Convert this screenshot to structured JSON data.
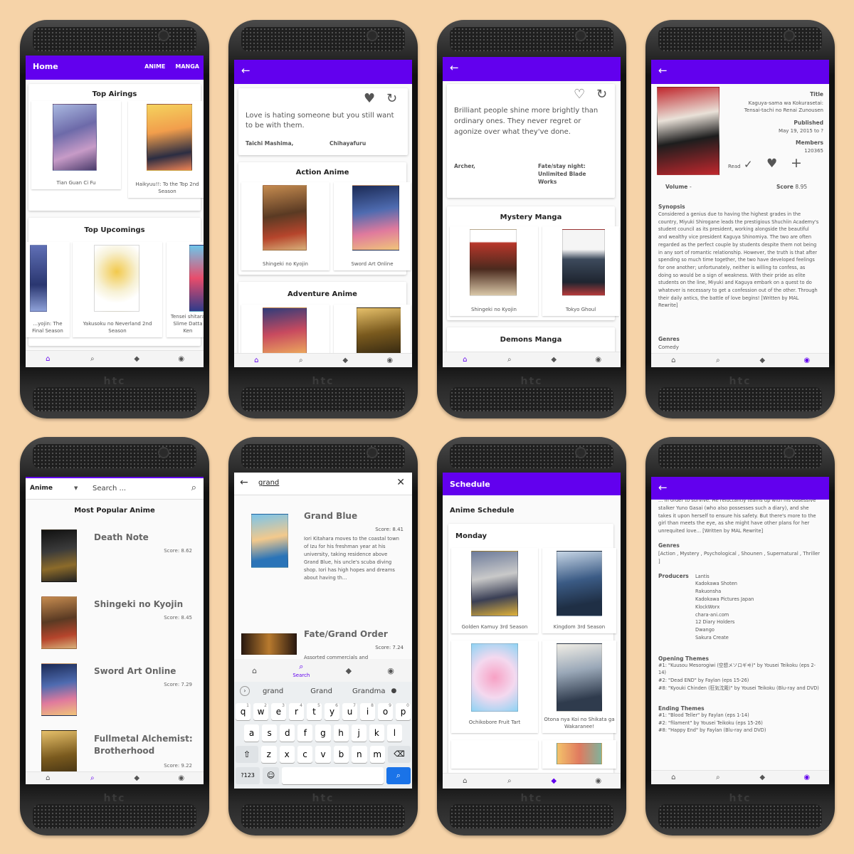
{
  "p1": {
    "title": "Home",
    "tab_anime": "ANIME",
    "tab_manga": "MANGA",
    "top_airings": "Top Airings",
    "air1": "Tian Guan Ci Fu",
    "air2": "Haikyuu!!: To the Top 2nd Season",
    "top_upcomings": "Top Upcomings",
    "up1": "...yojin: The Final Season",
    "up2": "Yakusoku no Neverland 2nd Season",
    "up3": "Tensei shitara Slime Datta Ken"
  },
  "p2": {
    "quote": "Love is hating someone but you still want to be with them.",
    "character": "Taichi Mashima,",
    "source": "Chihayafuru",
    "sec1": "Action Anime",
    "a1": "Shingeki no Kyojin",
    "a2": "Sword Art Online",
    "sec2": "Adventure Anime"
  },
  "p3": {
    "quote": "Brilliant people shine more brightly than ordinary ones. They never regret or agonize over what they've done.",
    "character": "Archer,",
    "source": "Fate/stay night: Unlimited Blade Works",
    "sec1": "Mystery Manga",
    "m1": "Shingeki no Kyojin",
    "m2": "Tokyo Ghoul",
    "sec2": "Demons Manga"
  },
  "p4": {
    "title_label": "Title",
    "title_value": "Kaguya-sama wa Kokurasetai: Tensai-tachi no Renai Zunousen",
    "published_label": "Published",
    "published_value": "May 19, 2015 to ?",
    "members_label": "Members",
    "members_value": "120365",
    "read_label": "Read",
    "volume_label": "Volume",
    "volume_value": "-",
    "score_label": "Score",
    "score_value": "8.95",
    "synopsis_label": "Synopsis",
    "synopsis": "Considered a genius due to having the highest grades in the country, Miyuki Shirogane leads the prestigious Shuchiin Academy's student council as its president, working alongside the beautiful and wealthy vice president Kaguya Shinomiya. The two are often regarded as the perfect couple by students despite them not being in any sort of romantic relationship. However, the truth is that after spending so much time together, the two have developed feelings for one another; unfortunately, neither is willing to confess, as doing so would be a sign of weakness. With their pride as elite students on the line, Miyuki and Kaguya embark on a quest to do whatever is necessary to get a confession out of the other. Through their daily antics, the battle of love begins! [Written by MAL Rewrite]",
    "genres_label": "Genres",
    "genres_value": "Comedy"
  },
  "p5": {
    "dropdown": "Anime",
    "search_placeholder": "Search ...",
    "heading": "Most Popular Anime",
    "items": [
      {
        "name": "Death Note",
        "score": "Score: 8.62"
      },
      {
        "name": "Shingeki no Kyojin",
        "score": "Score: 8.45"
      },
      {
        "name": "Sword Art Online",
        "score": "Score: 7.29"
      },
      {
        "name": "Fullmetal Alchemist: Brotherhood",
        "score": "Score: 9.22"
      }
    ]
  },
  "p6": {
    "query": "grand",
    "r1_title": "Grand Blue",
    "r1_score": "Score: 8.41",
    "r1_desc": "Iori Kitahara moves to the coastal town of Izu for his freshman year at his university, taking residence above Grand Blue, his uncle's scuba diving shop. Iori has high hopes and dreams about having th...",
    "r2_title": "Fate/Grand Order",
    "r2_score": "Score: 7.24",
    "r2_desc": "Assorted commercials and",
    "nav_search": "Search",
    "sugg": [
      "grand",
      "Grand",
      "Grandma"
    ],
    "row1": [
      "q",
      "w",
      "e",
      "r",
      "t",
      "y",
      "u",
      "i",
      "o",
      "p"
    ],
    "row1n": [
      "1",
      "2",
      "3",
      "4",
      "5",
      "6",
      "7",
      "8",
      "9",
      "0"
    ],
    "row2": [
      "a",
      "s",
      "d",
      "f",
      "g",
      "h",
      "j",
      "k",
      "l"
    ],
    "row3": [
      "z",
      "x",
      "c",
      "v",
      "b",
      "n",
      "m"
    ],
    "key123": "?123"
  },
  "p7": {
    "title": "Schedule",
    "heading": "Anime Schedule",
    "day": "Monday",
    "s1": "Golden Kamuy 3rd Season",
    "s2": "Kingdom 3rd Season",
    "s3": "Ochikobore Fruit Tart",
    "s4": "Otona nya Koi no Shikata ga Wakaranee!"
  },
  "p8": {
    "intro": "... in order to survive. He reluctantly teams up with his obsessive stalker Yuno Gasai (who also possesses such a diary), and she takes it upon herself to ensure his safety. But there's more to the girl than meets the eye, as she might have other plans for her unrequited love... [Written by MAL Rewrite]",
    "genres_label": "Genres",
    "genres_value": "[Action , Mystery , Psychological , Shounen , Supernatural , Thriller ]",
    "producers_label": "Producers",
    "producers": [
      "Lantis",
      "Kadokawa Shoten",
      "Rakuonsha",
      "Kadokawa Pictures Japan",
      "KlockWorx",
      "chara-ani.com",
      "12 Diary Holders",
      "Dwango",
      "Sakura Create"
    ],
    "op_label": "Opening Themes",
    "op": [
      "#1: \"Kuusou Mesorogiwi (空想メソロギヰ)\" by Yousei Teikoku (eps 2-14)",
      "#2: \"Dead END\" by Faylan (eps 15-26)",
      "#8: \"Kyouki Chinden (狂気沈殿)\" by Yousei Teikoku (Blu-ray and DVD)"
    ],
    "ed_label": "Ending Themes",
    "ed": [
      "#1: \"Blood Teller\" by Faylan (eps 1-14)",
      "#2: \"filament\" by Yousei Teikoku (eps 15-26)",
      "#8: \"Happy End\" by Faylan (Blu-ray and DVD)"
    ]
  },
  "phone_brand": "htc",
  "colors": {
    "accent": "#6200ee",
    "background": "#f6d3a8"
  }
}
